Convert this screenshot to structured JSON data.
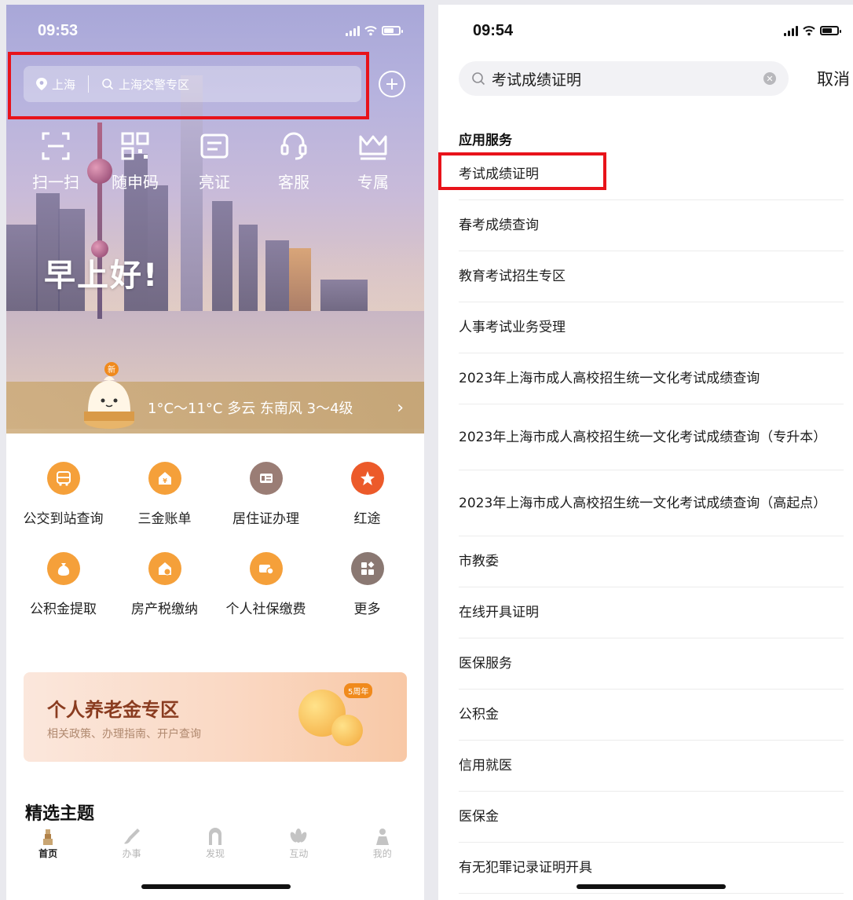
{
  "left": {
    "status": {
      "time": "09:53"
    },
    "search": {
      "city": "上海",
      "placeholder": "上海交警专区"
    },
    "quick_actions": [
      {
        "label": "扫一扫",
        "icon": "scan-icon"
      },
      {
        "label": "随申码",
        "icon": "qr-code-icon"
      },
      {
        "label": "亮证",
        "icon": "card-icon"
      },
      {
        "label": "客服",
        "icon": "customer-service-icon"
      },
      {
        "label": "专属",
        "icon": "crown-icon"
      }
    ],
    "greeting": "早上好!",
    "weather": {
      "badge": "新",
      "text": "1°C～11°C 多云 东南风 3～4级",
      "chevron": "›"
    },
    "services": [
      {
        "label": "公交到站查询",
        "icon": "bus-icon",
        "color": "#f5a03a"
      },
      {
        "label": "三金账单",
        "icon": "house-money-icon",
        "color": "#f5a03a"
      },
      {
        "label": "居住证办理",
        "icon": "residence-card-icon",
        "color": "#9a7d75"
      },
      {
        "label": "红途",
        "icon": "red-star-icon",
        "color": "#ec5a2a"
      },
      {
        "label": "公积金提取",
        "icon": "money-bag-icon",
        "color": "#f5a03a"
      },
      {
        "label": "房产税缴纳",
        "icon": "house-tax-icon",
        "color": "#f5a03a"
      },
      {
        "label": "个人社保缴费",
        "icon": "social-security-icon",
        "color": "#f5a03a"
      },
      {
        "label": "更多",
        "icon": "grid-more-icon",
        "color": "#8a7872"
      }
    ],
    "banner": {
      "title": "个人养老金专区",
      "subtitle": "相关政策、办理指南、开户查询",
      "badge": "5周年"
    },
    "section_title": "精选主题",
    "tabs": [
      {
        "label": "首页",
        "icon": "home-pagoda-icon",
        "active": true
      },
      {
        "label": "办事",
        "icon": "brush-icon",
        "active": false
      },
      {
        "label": "发现",
        "icon": "arch-icon",
        "active": false
      },
      {
        "label": "互动",
        "icon": "lotus-icon",
        "active": false
      },
      {
        "label": "我的",
        "icon": "person-icon",
        "active": false
      }
    ]
  },
  "right": {
    "status": {
      "time": "09:54"
    },
    "search": {
      "query": "考试成绩证明",
      "cancel": "取消"
    },
    "section_header": "应用服务",
    "results": [
      "考试成绩证明",
      "春考成绩查询",
      "教育考试招生专区",
      "人事考试业务受理",
      "2023年上海市成人高校招生统一文化考试成绩查询",
      "2023年上海市成人高校招生统一文化考试成绩查询（专升本）",
      "2023年上海市成人高校招生统一文化考试成绩查询（高起点）",
      "市教委",
      "在线开具证明",
      "医保服务",
      "公积金",
      "信用就医",
      "医保金",
      "有无犯罪记录证明开具"
    ]
  },
  "colors": {
    "highlight": "#e8131a",
    "accent_gold": "#c9a572"
  }
}
